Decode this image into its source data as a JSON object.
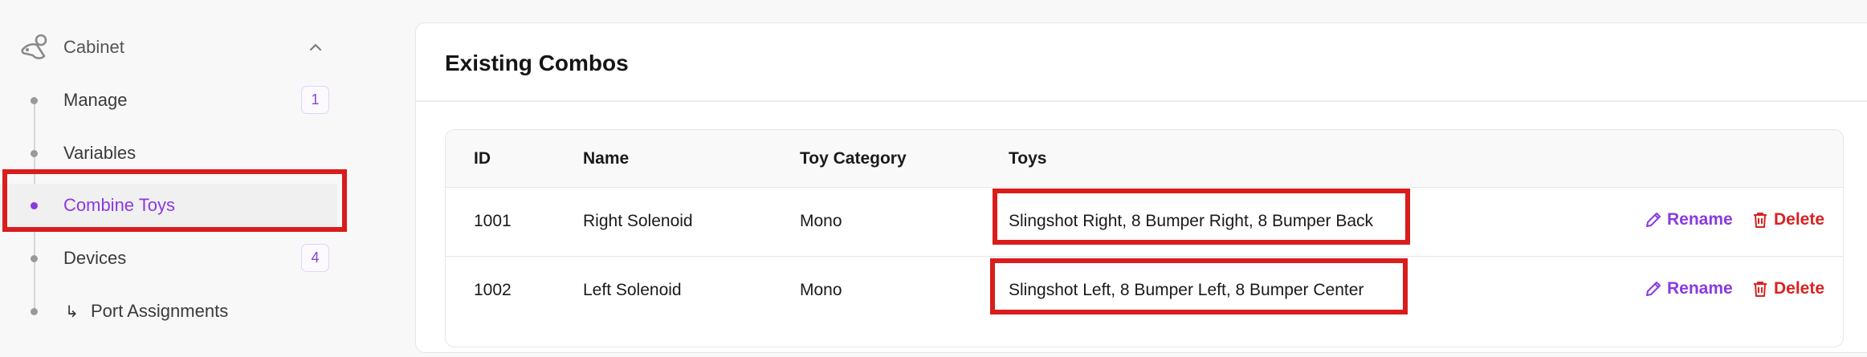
{
  "sidebar": {
    "section_label": "Cabinet",
    "items": [
      {
        "label": "Manage",
        "badge": "1"
      },
      {
        "label": "Variables"
      },
      {
        "label": "Combine Toys",
        "active": true
      },
      {
        "label": "Devices",
        "badge": "4"
      },
      {
        "label": "Port Assignments",
        "prefix": "↳"
      }
    ]
  },
  "main": {
    "title": "Existing Combos",
    "table": {
      "columns": [
        "ID",
        "Name",
        "Toy Category",
        "Toys"
      ],
      "rows": [
        {
          "id": "1001",
          "name": "Right Solenoid",
          "category": "Mono",
          "toys": "Slingshot Right, 8 Bumper Right, 8 Bumper Back"
        },
        {
          "id": "1002",
          "name": "Left Solenoid",
          "category": "Mono",
          "toys": "Slingshot Left, 8 Bumper Left, 8 Bumper Center"
        }
      ],
      "actions": {
        "rename": "Rename",
        "delete": "Delete"
      }
    }
  },
  "colors": {
    "accent": "#8a3ae0",
    "danger": "#d92222",
    "highlight": "#d91c1c"
  },
  "icons": {
    "section": "pinball-flipper-icon",
    "collapse": "chevron-up-icon",
    "rename": "pencil-icon",
    "delete": "trash-icon"
  }
}
